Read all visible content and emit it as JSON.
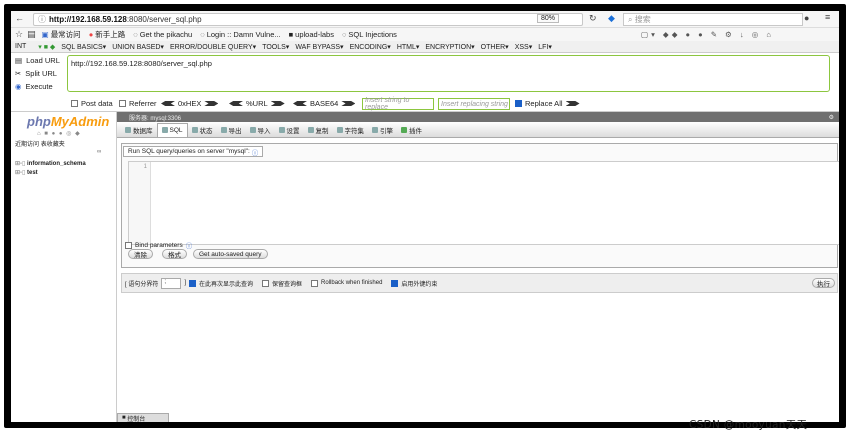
{
  "browser": {
    "url_host": "http://192.168.59.128",
    "url_path": ":8080/server_sql.php",
    "zoom": "80%",
    "search_placeholder": "搜索"
  },
  "bookmarks": [
    "最常访问",
    "新手上路",
    "Get the pikachu",
    "Login :: Damn Vulne...",
    "upload-labs",
    "SQL Injections"
  ],
  "hackbar": {
    "type": "INT",
    "menu": [
      "SQL BASICS▾",
      "UNION BASED▾",
      "ERROR/DOUBLE QUERY▾",
      "TOOLS▾",
      "WAF BYPASS▾",
      "ENCODING▾",
      "HTML▾",
      "ENCRYPTION▾",
      "OTHER▾",
      "XSS▾",
      "LFI▾"
    ],
    "load_url": "Load URL",
    "split_url": "Split URL",
    "execute": "Execute",
    "url_value": "http://192.168.59.128:8080/server_sql.php",
    "post_data": "Post data",
    "referrer": "Referrer",
    "hex": "0xHEX",
    "url_enc": "%URL",
    "base64": "BASE64",
    "replace_placeholder": "Insert string to replace",
    "replacing_placeholder": "Insert replacing string",
    "replace_all": "Replace All"
  },
  "pma": {
    "logo_a": "php",
    "logo_b": "MyAdmin",
    "recent": "近期访问",
    "fav": "表收藏夹",
    "databases": [
      "information_schema",
      "test"
    ],
    "server": "服务器: mysql:3306",
    "tabs": [
      "数据库",
      "SQL",
      "状态",
      "导出",
      "导入",
      "设置",
      "复制",
      "字符集",
      "引擎",
      "插件"
    ],
    "legend": "Run SQL query/queries on server \"mysql\":",
    "line_no": "1",
    "btn_clear": "清除",
    "btn_format": "格式",
    "btn_autosave": "Get auto-saved query",
    "bind_params": "Bind parameters",
    "delim_label": "[ 语句分界符",
    "delim_value": ";",
    "delim_close": "]",
    "opt1": "在此再次显示此查询",
    "opt2": "保留查询框",
    "opt3": "Rollback when finished",
    "opt4": "启用外键约束",
    "go": "执行",
    "console": "控制台"
  },
  "watermark": "CSDN @mooyuan天天"
}
